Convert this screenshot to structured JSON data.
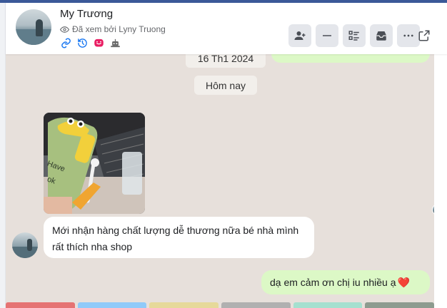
{
  "header": {
    "contact_name": "My Trương",
    "seen_text": "Đã xem bởi Lyny Truong",
    "mini_icons": [
      "link-icon",
      "history-icon",
      "chat-bubble-icon",
      "robot-icon"
    ],
    "actions": [
      "add-person-icon",
      "minus-icon",
      "list-icon",
      "inbox-icon",
      "more-icon"
    ],
    "external": "external-link-icon"
  },
  "chat": {
    "date_divider": "16 Th1 2024",
    "today_divider": "Hôm nay",
    "received_message": "Mới nhận hàng chất lượng dễ thương nữa bé nhà mình rất thích nha shop",
    "sent_message": "dạ em cảm ơn chị iu nhiều ạ",
    "sent_emoji": "❤️"
  },
  "colors": {
    "chat_background": "#e7e0db",
    "sent_bubble": "#dcf8c6",
    "label_strip": [
      "#e57373",
      "#90caf9",
      "#e6d99a",
      "#b0b0b0",
      "#a5e0cf",
      "#8d9b8f"
    ]
  }
}
